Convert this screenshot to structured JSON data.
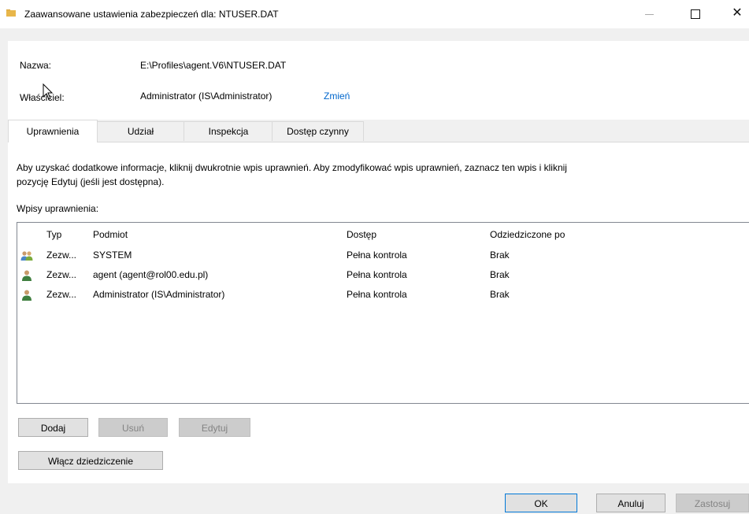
{
  "window": {
    "title": "Zaawansowane ustawienia zabezpieczeń dla: NTUSER.DAT",
    "close_glyph": "✕"
  },
  "info": {
    "name_label": "Nazwa:",
    "name_value": "E:\\Profiles\\agent.V6\\NTUSER.DAT",
    "owner_label": "Właściciel:",
    "owner_value": "Administrator (IS\\Administrator)",
    "owner_change": "Zmień"
  },
  "tabs": [
    {
      "label": "Uprawnienia",
      "active": true
    },
    {
      "label": "Udział",
      "active": false
    },
    {
      "label": "Inspekcja",
      "active": false
    },
    {
      "label": "Dostęp czynny",
      "active": false
    }
  ],
  "permissions": {
    "description_line1": "Aby uzyskać dodatkowe informacje, kliknij dwukrotnie wpis uprawnień. Aby zmodyfikować wpis uprawnień, zaznacz ten wpis i kliknij",
    "description_line2": "pozycję Edytuj (jeśli jest dostępna).",
    "entries_label": "Wpisy uprawnienia:",
    "columns": [
      "Typ",
      "Podmiot",
      "Dostęp",
      "Odziedziczone po"
    ],
    "rows": [
      {
        "icon": "group-icon",
        "type": "Zezw...",
        "principal": "SYSTEM",
        "access": "Pełna kontrola",
        "inherited": "Brak"
      },
      {
        "icon": "user-icon",
        "type": "Zezw...",
        "principal": "agent (agent@rol00.edu.pl)",
        "access": "Pełna kontrola",
        "inherited": "Brak"
      },
      {
        "icon": "user-icon",
        "type": "Zezw...",
        "principal": "Administrator (IS\\Administrator)",
        "access": "Pełna kontrola",
        "inherited": "Brak"
      }
    ]
  },
  "buttons": {
    "add": "Dodaj",
    "remove": "Usuń",
    "edit": "Edytuj",
    "enable_inheritance": "Włącz dziedziczenie",
    "ok": "OK",
    "cancel": "Anuluj",
    "apply": "Zastosuj"
  },
  "colors": {
    "link": "#0066cc",
    "accent": "#0078d7",
    "folder": "#e8b64a"
  }
}
